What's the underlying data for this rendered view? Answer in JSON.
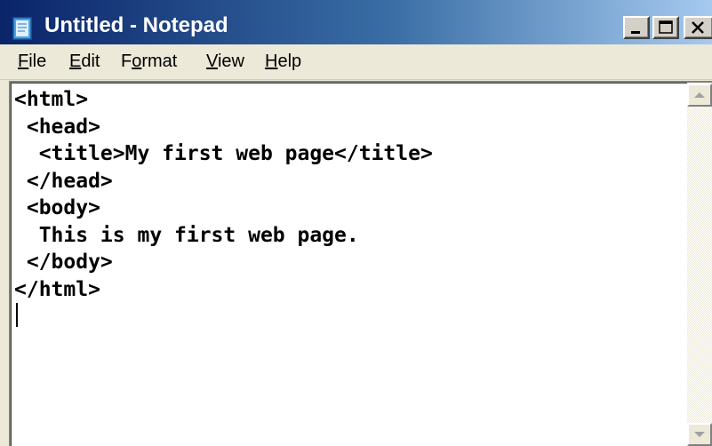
{
  "window": {
    "title": "Untitled - Notepad",
    "icon": "notepad-icon"
  },
  "menubar": {
    "items": [
      {
        "accel": "F",
        "rest": "ile"
      },
      {
        "accel": "E",
        "rest": "dit"
      },
      {
        "pre": "F",
        "accel": "o",
        "rest": "rmat"
      },
      {
        "accel": "V",
        "rest": "iew"
      },
      {
        "accel": "H",
        "rest": "elp"
      }
    ]
  },
  "editor": {
    "lines": [
      "<html>",
      " <head>",
      "  <title>My first web page</title>",
      " </head>",
      " <body>",
      "  This is my first web page.",
      " </body>",
      "</html>"
    ]
  },
  "colors": {
    "titlebar_start": "#0a246a",
    "titlebar_end": "#a6caf0",
    "chrome": "#ece9d8",
    "text": "#000000"
  }
}
